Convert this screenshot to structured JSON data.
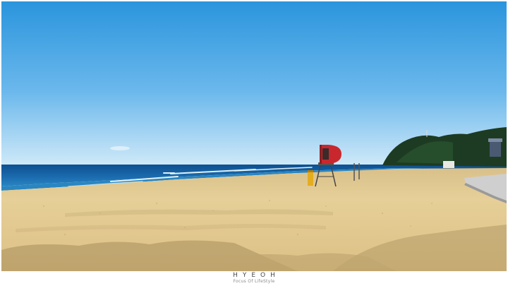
{
  "watermark": {
    "brand": "HYEOH",
    "tagline": "Focus Of LifeStyle"
  },
  "colors": {
    "sky_top": "#2b95dd",
    "sky_horizon": "#cfe9f8",
    "sea_far": "#0d4f8f",
    "sea_near": "#2a86c1",
    "surf": "#dff2f7",
    "sand_light": "#e6cf98",
    "sand_shadow": "#a88e5c",
    "lifeguard_tower": "#c8282d",
    "hill": "#1d3b22"
  },
  "scene": {
    "elements": [
      "sky",
      "sea",
      "surf",
      "beach-sand",
      "lifeguard-tower",
      "yellow-post",
      "wooded-hill",
      "boardwalk",
      "shadows"
    ]
  }
}
